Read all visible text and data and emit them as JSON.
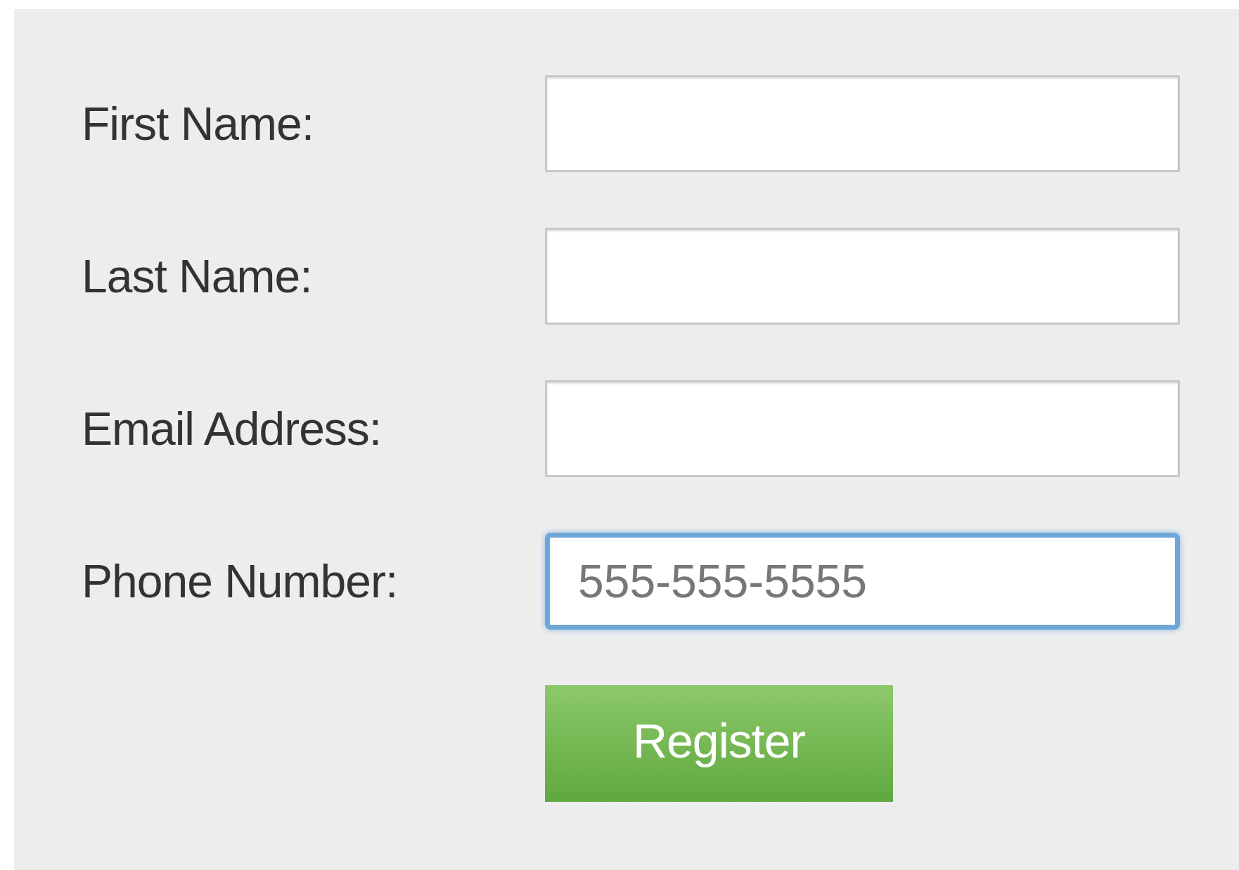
{
  "form": {
    "fields": [
      {
        "label": "First Name:",
        "focused": false
      },
      {
        "label": "Last Name:",
        "focused": false
      },
      {
        "label": "Email Address:",
        "focused": false
      },
      {
        "label": "Phone Number:",
        "placeholder": "555-555-5555",
        "focused": true
      }
    ],
    "submit": {
      "label": "Register"
    }
  }
}
